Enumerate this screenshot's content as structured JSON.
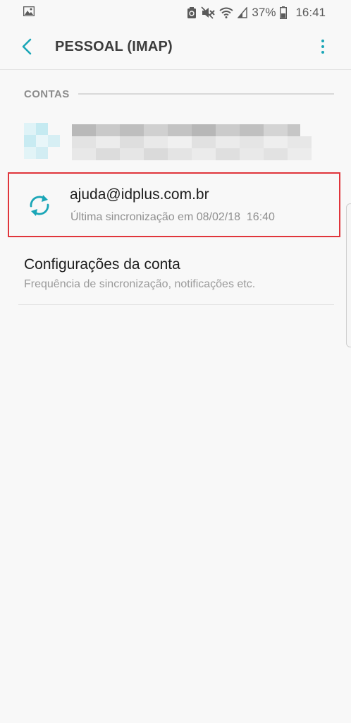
{
  "status_bar": {
    "battery_percent": "37%",
    "time": "16:41",
    "icons": [
      "gallery-icon",
      "sync-status-icon",
      "mute-icon",
      "wifi-icon",
      "signal-icon",
      "battery-icon"
    ]
  },
  "app_bar": {
    "title": "PESSOAL (IMAP)",
    "icons": [
      "back-arrow-icon",
      "more-options-icon"
    ]
  },
  "section": {
    "label": "CONTAS"
  },
  "account": {
    "email": "ajuda@idplus.com.br",
    "sync_status": "Última sincronização em 08/02/18  16:40",
    "icon": "sync-icon"
  },
  "settings": {
    "title": "Configurações da conta",
    "subtitle": "Frequência de sincronização, notificações etc."
  },
  "colors": {
    "accent": "#1aa6b7",
    "highlight_border": "#e0353b",
    "background": "#f8f8f8"
  }
}
